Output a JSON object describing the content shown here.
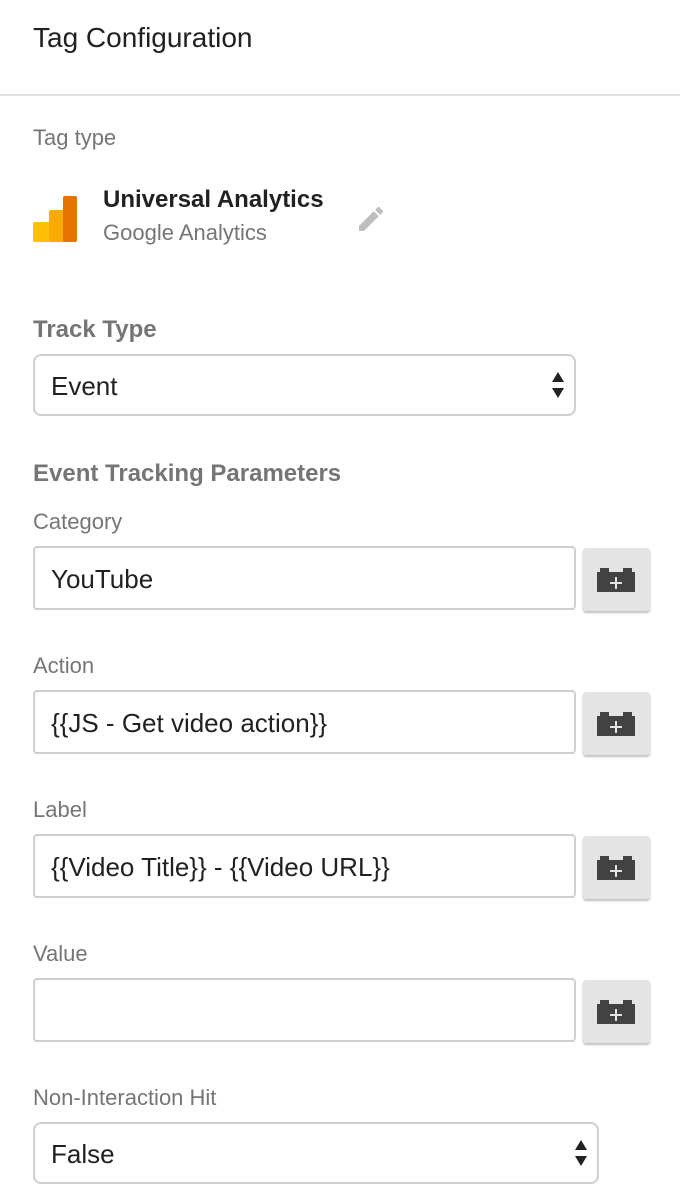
{
  "header": {
    "title": "Tag Configuration"
  },
  "tag_type": {
    "label": "Tag type",
    "name": "Universal Analytics",
    "provider": "Google Analytics",
    "logo_icon": "google-analytics-icon",
    "edit_icon": "pencil-icon"
  },
  "track_type": {
    "label": "Track Type",
    "value": "Event"
  },
  "event_params": {
    "title": "Event Tracking Parameters",
    "category": {
      "label": "Category",
      "value": "YouTube"
    },
    "action": {
      "label": "Action",
      "value": "{{JS - Get video action}}"
    },
    "label_field": {
      "label": "Label",
      "value": "{{Video Title}} - {{Video URL}}"
    },
    "value_field": {
      "label": "Value",
      "value": ""
    },
    "variable_icon": "variable-picker-icon"
  },
  "non_interaction": {
    "label": "Non-Interaction Hit",
    "value": "False"
  },
  "colors": {
    "ga_orange_dark": "#E37400",
    "ga_orange": "#F9AB00",
    "ga_yellow": "#FFC107",
    "label_gray": "#757575",
    "icon_gray": "#424242",
    "button_bg": "#E4E4E4"
  }
}
